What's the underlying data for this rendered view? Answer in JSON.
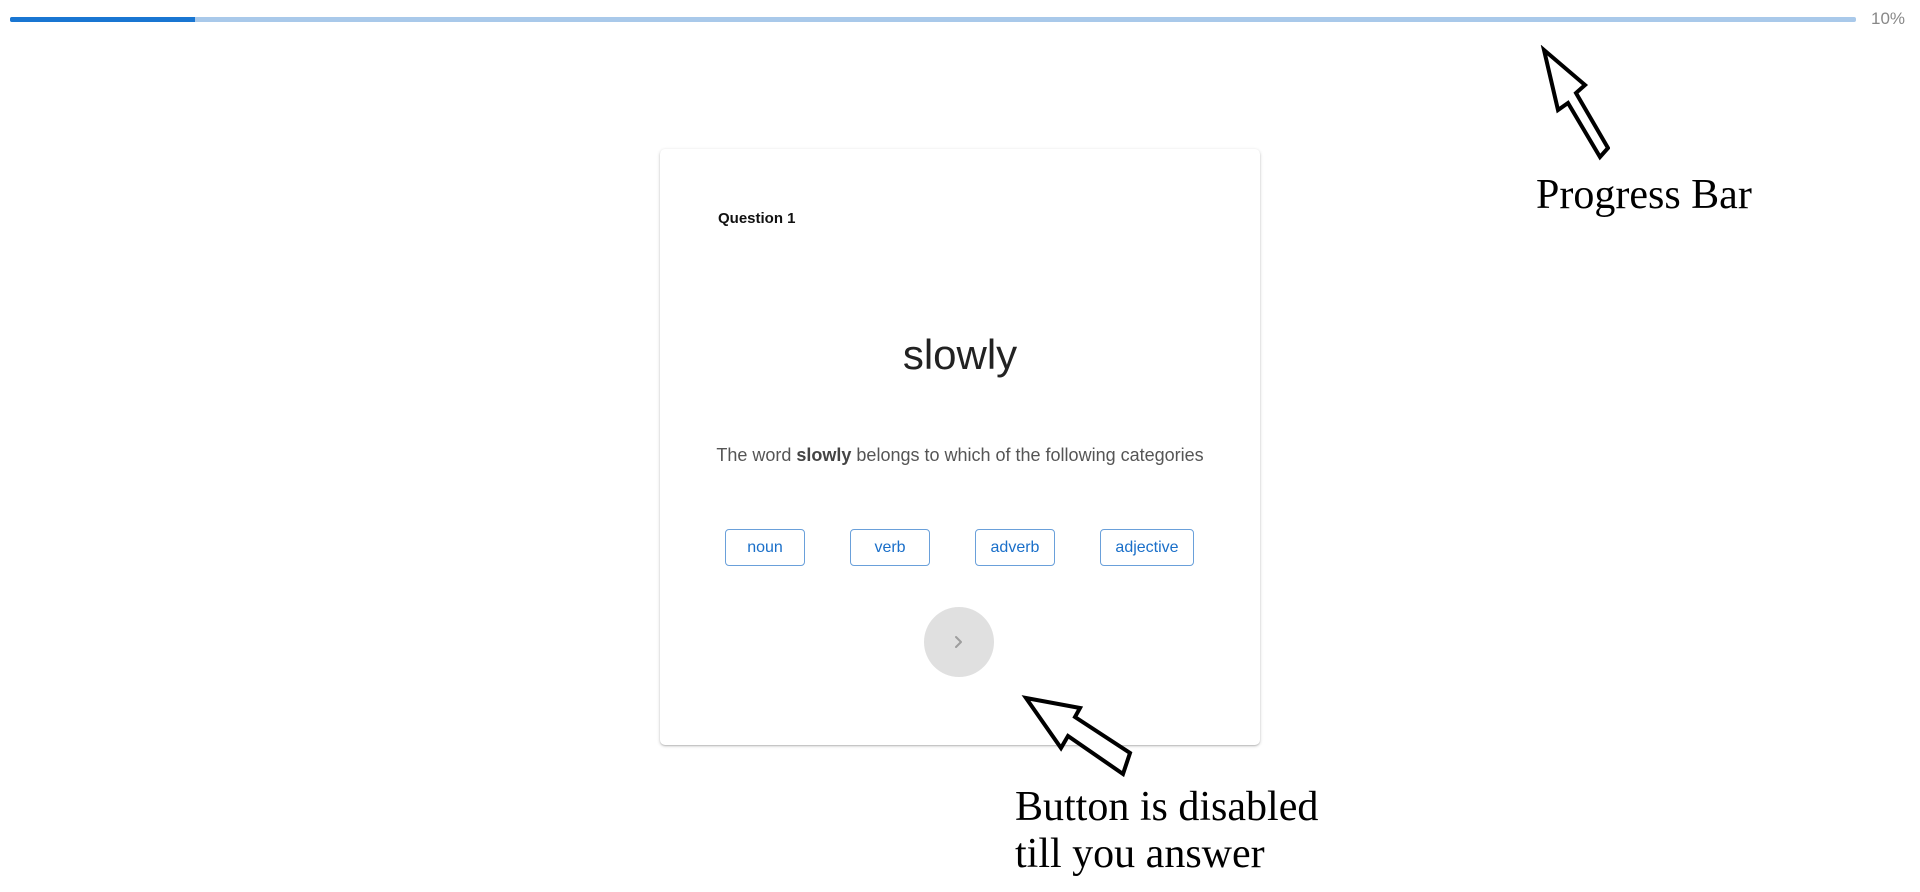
{
  "progress": {
    "percent_label": "10%",
    "value": 0.1,
    "fill_color": "#1976d2",
    "track_color": "#a9c9ea"
  },
  "question": {
    "number_label": "Question 1",
    "word": "slowly",
    "prompt_before": "The word ",
    "prompt_word": "slowly",
    "prompt_after": " belongs to which of the following categories"
  },
  "options": [
    "noun",
    "verb",
    "adverb",
    "adjective"
  ],
  "next_button": {
    "icon": "chevron-right-icon",
    "disabled": true
  },
  "annotations": {
    "progress_label": "Progress Bar",
    "button_label_line1": "Button is disabled",
    "button_label_line2": "till you answer"
  }
}
